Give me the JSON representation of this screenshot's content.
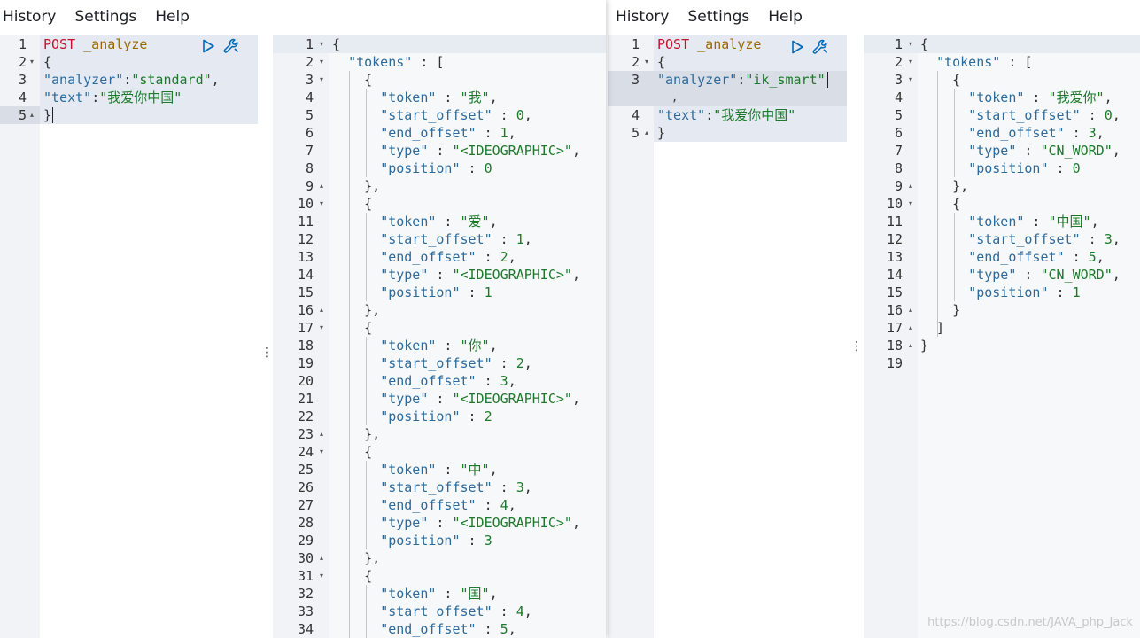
{
  "menu": [
    "History",
    "Settings",
    "Help"
  ],
  "consoles": [
    {
      "request": {
        "lines": [
          [
            [
              "POST",
              "kw"
            ],
            [
              " ",
              "pun"
            ],
            [
              "_analyze",
              "url"
            ]
          ],
          [
            [
              "{",
              "pun"
            ]
          ],
          [
            [
              "\"analyzer\"",
              "key"
            ],
            [
              ":",
              "pun"
            ],
            [
              "\"standard\"",
              "str"
            ],
            [
              ",",
              "pun"
            ]
          ],
          [
            [
              "\"text\"",
              "key"
            ],
            [
              ":",
              "pun"
            ],
            [
              "\"我爱你中国\"",
              "str"
            ]
          ],
          [
            [
              "}",
              "pun"
            ]
          ]
        ]
      },
      "response": {
        "lines": [
          [
            [
              "{",
              "pun"
            ]
          ],
          [
            [
              "  ",
              "pun"
            ],
            [
              "\"tokens\"",
              "key"
            ],
            [
              " : [",
              "pun"
            ]
          ],
          [
            [
              "    {",
              "pun"
            ]
          ],
          [
            [
              "      ",
              "pun"
            ],
            [
              "\"token\"",
              "key"
            ],
            [
              " : ",
              "pun"
            ],
            [
              "\"我\"",
              "str"
            ],
            [
              ",",
              "pun"
            ]
          ],
          [
            [
              "      ",
              "pun"
            ],
            [
              "\"start_offset\"",
              "key"
            ],
            [
              " : ",
              "pun"
            ],
            [
              "0",
              "num"
            ],
            [
              ",",
              "pun"
            ]
          ],
          [
            [
              "      ",
              "pun"
            ],
            [
              "\"end_offset\"",
              "key"
            ],
            [
              " : ",
              "pun"
            ],
            [
              "1",
              "num"
            ],
            [
              ",",
              "pun"
            ]
          ],
          [
            [
              "      ",
              "pun"
            ],
            [
              "\"type\"",
              "key"
            ],
            [
              " : ",
              "pun"
            ],
            [
              "\"<IDEOGRAPHIC>\"",
              "str"
            ],
            [
              ",",
              "pun"
            ]
          ],
          [
            [
              "      ",
              "pun"
            ],
            [
              "\"position\"",
              "key"
            ],
            [
              " : ",
              "pun"
            ],
            [
              "0",
              "num"
            ]
          ],
          [
            [
              "    },",
              "pun"
            ]
          ],
          [
            [
              "    {",
              "pun"
            ]
          ],
          [
            [
              "      ",
              "pun"
            ],
            [
              "\"token\"",
              "key"
            ],
            [
              " : ",
              "pun"
            ],
            [
              "\"爱\"",
              "str"
            ],
            [
              ",",
              "pun"
            ]
          ],
          [
            [
              "      ",
              "pun"
            ],
            [
              "\"start_offset\"",
              "key"
            ],
            [
              " : ",
              "pun"
            ],
            [
              "1",
              "num"
            ],
            [
              ",",
              "pun"
            ]
          ],
          [
            [
              "      ",
              "pun"
            ],
            [
              "\"end_offset\"",
              "key"
            ],
            [
              " : ",
              "pun"
            ],
            [
              "2",
              "num"
            ],
            [
              ",",
              "pun"
            ]
          ],
          [
            [
              "      ",
              "pun"
            ],
            [
              "\"type\"",
              "key"
            ],
            [
              " : ",
              "pun"
            ],
            [
              "\"<IDEOGRAPHIC>\"",
              "str"
            ],
            [
              ",",
              "pun"
            ]
          ],
          [
            [
              "      ",
              "pun"
            ],
            [
              "\"position\"",
              "key"
            ],
            [
              " : ",
              "pun"
            ],
            [
              "1",
              "num"
            ]
          ],
          [
            [
              "    },",
              "pun"
            ]
          ],
          [
            [
              "    {",
              "pun"
            ]
          ],
          [
            [
              "      ",
              "pun"
            ],
            [
              "\"token\"",
              "key"
            ],
            [
              " : ",
              "pun"
            ],
            [
              "\"你\"",
              "str"
            ],
            [
              ",",
              "pun"
            ]
          ],
          [
            [
              "      ",
              "pun"
            ],
            [
              "\"start_offset\"",
              "key"
            ],
            [
              " : ",
              "pun"
            ],
            [
              "2",
              "num"
            ],
            [
              ",",
              "pun"
            ]
          ],
          [
            [
              "      ",
              "pun"
            ],
            [
              "\"end_offset\"",
              "key"
            ],
            [
              " : ",
              "pun"
            ],
            [
              "3",
              "num"
            ],
            [
              ",",
              "pun"
            ]
          ],
          [
            [
              "      ",
              "pun"
            ],
            [
              "\"type\"",
              "key"
            ],
            [
              " : ",
              "pun"
            ],
            [
              "\"<IDEOGRAPHIC>\"",
              "str"
            ],
            [
              ",",
              "pun"
            ]
          ],
          [
            [
              "      ",
              "pun"
            ],
            [
              "\"position\"",
              "key"
            ],
            [
              " : ",
              "pun"
            ],
            [
              "2",
              "num"
            ]
          ],
          [
            [
              "    },",
              "pun"
            ]
          ],
          [
            [
              "    {",
              "pun"
            ]
          ],
          [
            [
              "      ",
              "pun"
            ],
            [
              "\"token\"",
              "key"
            ],
            [
              " : ",
              "pun"
            ],
            [
              "\"中\"",
              "str"
            ],
            [
              ",",
              "pun"
            ]
          ],
          [
            [
              "      ",
              "pun"
            ],
            [
              "\"start_offset\"",
              "key"
            ],
            [
              " : ",
              "pun"
            ],
            [
              "3",
              "num"
            ],
            [
              ",",
              "pun"
            ]
          ],
          [
            [
              "      ",
              "pun"
            ],
            [
              "\"end_offset\"",
              "key"
            ],
            [
              " : ",
              "pun"
            ],
            [
              "4",
              "num"
            ],
            [
              ",",
              "pun"
            ]
          ],
          [
            [
              "      ",
              "pun"
            ],
            [
              "\"type\"",
              "key"
            ],
            [
              " : ",
              "pun"
            ],
            [
              "\"<IDEOGRAPHIC>\"",
              "str"
            ],
            [
              ",",
              "pun"
            ]
          ],
          [
            [
              "      ",
              "pun"
            ],
            [
              "\"position\"",
              "key"
            ],
            [
              " : ",
              "pun"
            ],
            [
              "3",
              "num"
            ]
          ],
          [
            [
              "    },",
              "pun"
            ]
          ],
          [
            [
              "    {",
              "pun"
            ]
          ],
          [
            [
              "      ",
              "pun"
            ],
            [
              "\"token\"",
              "key"
            ],
            [
              " : ",
              "pun"
            ],
            [
              "\"国\"",
              "str"
            ],
            [
              ",",
              "pun"
            ]
          ],
          [
            [
              "      ",
              "pun"
            ],
            [
              "\"start_offset\"",
              "key"
            ],
            [
              " : ",
              "pun"
            ],
            [
              "4",
              "num"
            ],
            [
              ",",
              "pun"
            ]
          ],
          [
            [
              "      ",
              "pun"
            ],
            [
              "\"end_offset\"",
              "key"
            ],
            [
              " : ",
              "pun"
            ],
            [
              "5",
              "num"
            ],
            [
              ",",
              "pun"
            ]
          ]
        ]
      }
    },
    {
      "request": {
        "lines": [
          [
            [
              "POST",
              "kw"
            ],
            [
              " ",
              "pun"
            ],
            [
              "_analyze",
              "url"
            ]
          ],
          [
            [
              "{",
              "pun"
            ]
          ],
          [
            [
              "\"analyzer\"",
              "key"
            ],
            [
              ":",
              "pun"
            ],
            [
              "\"ik_smart\"",
              "str"
            ],
            [
              ",",
              "pun"
            ]
          ],
          [
            [
              "\"text\"",
              "key"
            ],
            [
              ":",
              "pun"
            ],
            [
              "\"我爱你中国\"",
              "str"
            ]
          ],
          [
            [
              "}",
              "pun"
            ]
          ]
        ]
      },
      "response": {
        "lines": [
          [
            [
              "{",
              "pun"
            ]
          ],
          [
            [
              "  ",
              "pun"
            ],
            [
              "\"tokens\"",
              "key"
            ],
            [
              " : [",
              "pun"
            ]
          ],
          [
            [
              "    {",
              "pun"
            ]
          ],
          [
            [
              "      ",
              "pun"
            ],
            [
              "\"token\"",
              "key"
            ],
            [
              " : ",
              "pun"
            ],
            [
              "\"我爱你\"",
              "str"
            ],
            [
              ",",
              "pun"
            ]
          ],
          [
            [
              "      ",
              "pun"
            ],
            [
              "\"start_offset\"",
              "key"
            ],
            [
              " : ",
              "pun"
            ],
            [
              "0",
              "num"
            ],
            [
              ",",
              "pun"
            ]
          ],
          [
            [
              "      ",
              "pun"
            ],
            [
              "\"end_offset\"",
              "key"
            ],
            [
              " : ",
              "pun"
            ],
            [
              "3",
              "num"
            ],
            [
              ",",
              "pun"
            ]
          ],
          [
            [
              "      ",
              "pun"
            ],
            [
              "\"type\"",
              "key"
            ],
            [
              " : ",
              "pun"
            ],
            [
              "\"CN_WORD\"",
              "str"
            ],
            [
              ",",
              "pun"
            ]
          ],
          [
            [
              "      ",
              "pun"
            ],
            [
              "\"position\"",
              "key"
            ],
            [
              " : ",
              "pun"
            ],
            [
              "0",
              "num"
            ]
          ],
          [
            [
              "    },",
              "pun"
            ]
          ],
          [
            [
              "    {",
              "pun"
            ]
          ],
          [
            [
              "      ",
              "pun"
            ],
            [
              "\"token\"",
              "key"
            ],
            [
              " : ",
              "pun"
            ],
            [
              "\"中国\"",
              "str"
            ],
            [
              ",",
              "pun"
            ]
          ],
          [
            [
              "      ",
              "pun"
            ],
            [
              "\"start_offset\"",
              "key"
            ],
            [
              " : ",
              "pun"
            ],
            [
              "3",
              "num"
            ],
            [
              ",",
              "pun"
            ]
          ],
          [
            [
              "      ",
              "pun"
            ],
            [
              "\"end_offset\"",
              "key"
            ],
            [
              " : ",
              "pun"
            ],
            [
              "5",
              "num"
            ],
            [
              ",",
              "pun"
            ]
          ],
          [
            [
              "      ",
              "pun"
            ],
            [
              "\"type\"",
              "key"
            ],
            [
              " : ",
              "pun"
            ],
            [
              "\"CN_WORD\"",
              "str"
            ],
            [
              ",",
              "pun"
            ]
          ],
          [
            [
              "      ",
              "pun"
            ],
            [
              "\"position\"",
              "key"
            ],
            [
              " : ",
              "pun"
            ],
            [
              "1",
              "num"
            ]
          ],
          [
            [
              "    }",
              "pun"
            ]
          ],
          [
            [
              "  ]",
              "pun"
            ]
          ],
          [
            [
              "}",
              "pun"
            ]
          ],
          [
            [
              "",
              "pun"
            ]
          ]
        ]
      }
    }
  ],
  "watermark": "https://blog.csdn.net/JAVA_php_Jack",
  "colors": {
    "key": "#2c6b9c",
    "string": "#1d7a2a",
    "method": "#c8102e",
    "path": "#9a6a00",
    "gutter": "#f1f3f6",
    "active_line": "#e7ebf2",
    "selection": "#dde4f0",
    "action_icon": "#006bb8"
  },
  "icons": [
    "play-icon",
    "wrench-icon",
    "vertical-ellipsis-icon"
  ]
}
